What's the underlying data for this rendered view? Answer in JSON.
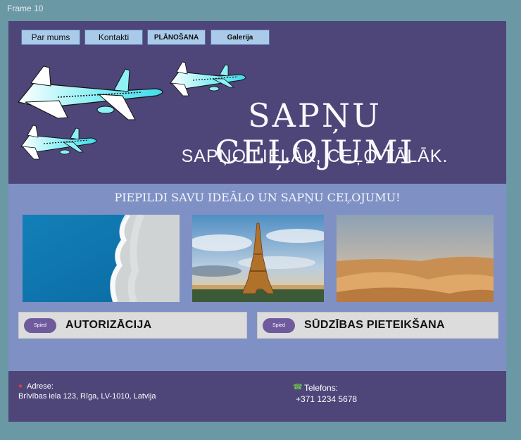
{
  "frame_label": "Frame 10",
  "nav": [
    {
      "label": "Par mums"
    },
    {
      "label": "Kontakti"
    },
    {
      "label": "PLĀNOŠANA"
    },
    {
      "label": "Galerija"
    }
  ],
  "hero": {
    "title": "SAPŅU CEĻOJUMI",
    "subtitle": "SAPŅO LIELĀK, CEĻO TĀLĀK."
  },
  "tagline": "PIEPILDI SAVU IDEĀLO UN SAPŅU CEĻOJUMU!",
  "photos": [
    {
      "icon": "ocean-beach-image"
    },
    {
      "icon": "eiffel-tower-image"
    },
    {
      "icon": "desert-dunes-image"
    }
  ],
  "actions": [
    {
      "pill": "Spied",
      "label": "AUTORIZĀCIJA"
    },
    {
      "pill": "Spied",
      "label": "SŪDZĪBAS PIETEIKŠANA"
    }
  ],
  "footer": {
    "address_label": "Adrese:",
    "address_value": "Brīvības iela 123, Rīga, LV-1010, Latvija",
    "phone_label": "Telefons:",
    "phone_value": "+371 1234 5678"
  },
  "colors": {
    "background": "#6b98a5",
    "header": "#4e4579",
    "body": "#7f91c4",
    "nav_button": "#a9cbe9",
    "pill": "#6f5a9d",
    "plane_accent": "#4fe3ee"
  }
}
